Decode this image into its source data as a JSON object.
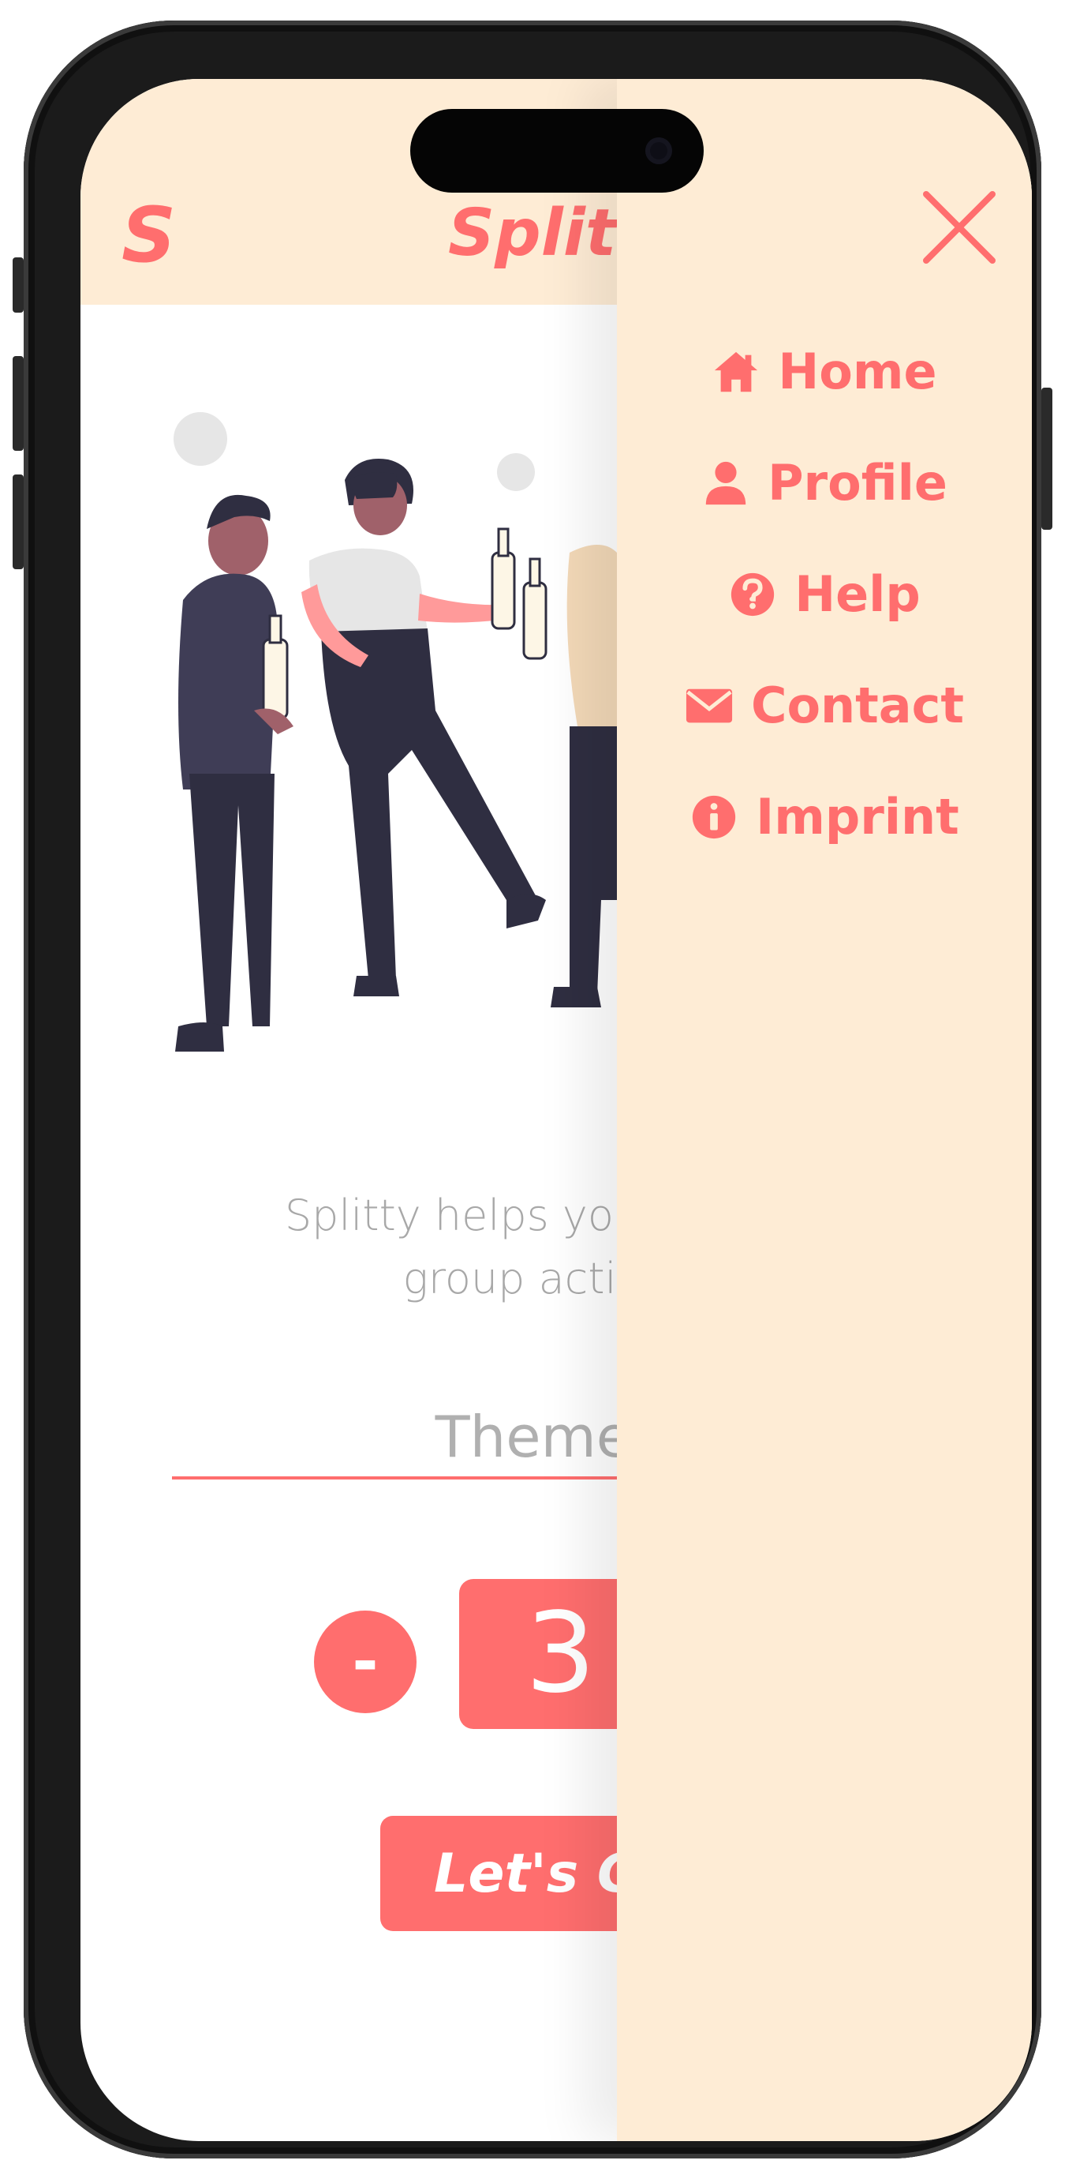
{
  "header": {
    "logo_glyph": "S",
    "title": "Splitt"
  },
  "main": {
    "tagline_line1": "Splitty helps you to sp",
    "tagline_line2": "group activ",
    "theme_input_placeholder": "Theme F",
    "decrement_label": "-",
    "count_value": "3",
    "go_button_label": "Let's G"
  },
  "drawer": {
    "close_icon": "close-icon",
    "items": [
      {
        "label": "Home",
        "icon": "home-icon"
      },
      {
        "label": "Profile",
        "icon": "user-icon"
      },
      {
        "label": "Help",
        "icon": "question-circle-icon"
      },
      {
        "label": "Contact",
        "icon": "envelope-icon"
      },
      {
        "label": "Imprint",
        "icon": "info-circle-icon"
      }
    ]
  },
  "colors": {
    "accent": "#ff6e6e",
    "header_bg": "#feecd5",
    "muted_text": "#a8a8a8",
    "figure_dark": "#2f2e41",
    "figure_light": "#e6e6e6"
  }
}
